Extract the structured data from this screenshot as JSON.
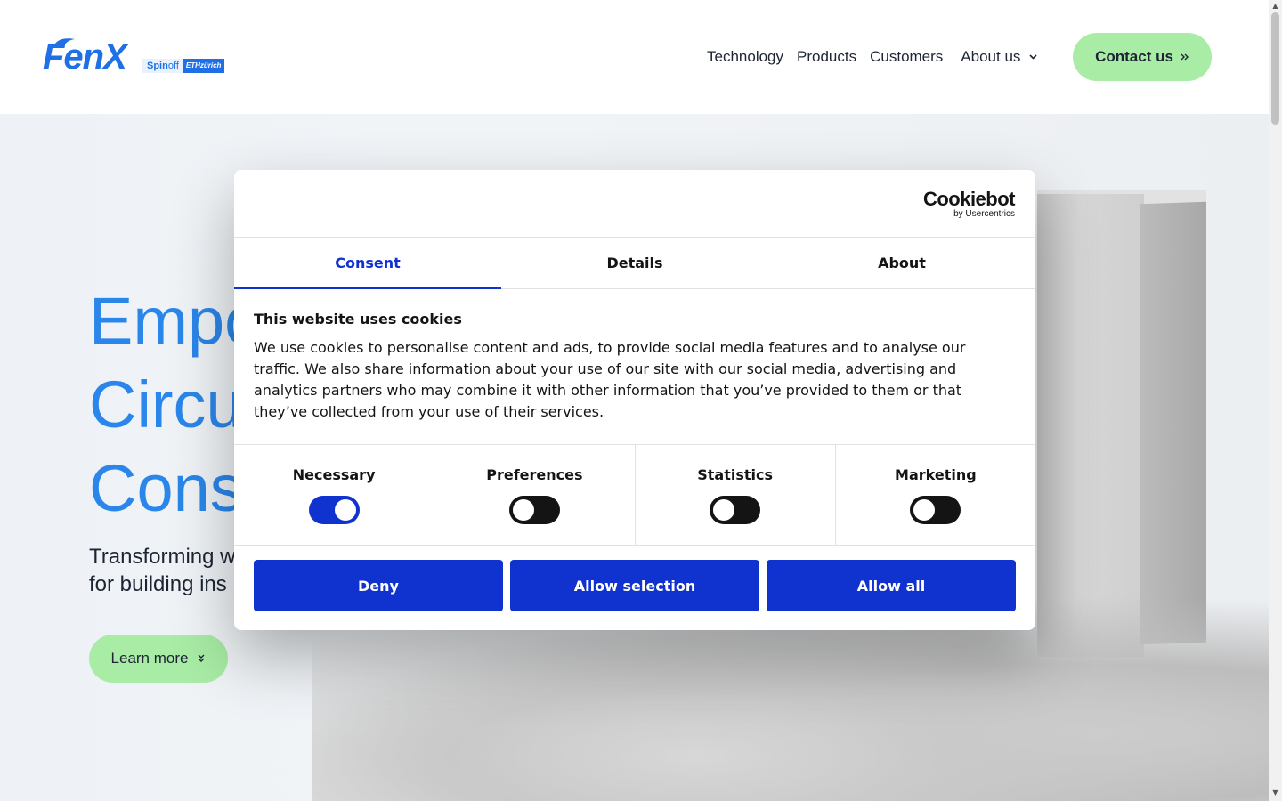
{
  "header": {
    "logo": "FenX",
    "badge": {
      "spin": "Spin",
      "off": "off",
      "eth": "ETHzürich"
    },
    "nav": [
      {
        "label": "Technology"
      },
      {
        "label": "Products"
      },
      {
        "label": "Customers"
      },
      {
        "label": "About us"
      }
    ],
    "contact_label": "Contact us",
    "contact_icon": "double-chevron-right-icon"
  },
  "hero": {
    "title_lines": [
      "Empo",
      "Circu",
      "Cons"
    ],
    "subtitle_lines": [
      "Transforming w",
      "for building ins"
    ],
    "learn_label": "Learn more",
    "learn_icon": "double-chevron-down-icon"
  },
  "cookie": {
    "brand": "Cookiebot",
    "brand_sub": "by Usercentrics",
    "tabs": [
      {
        "label": "Consent",
        "active": true
      },
      {
        "label": "Details",
        "active": false
      },
      {
        "label": "About",
        "active": false
      }
    ],
    "heading": "This website uses cookies",
    "body": "We use cookies to personalise content and ads, to provide social media features and to analyse our traffic. We also share information about your use of our site with our social media, advertising and analytics partners who may combine it with other information that you’ve provided to them or that they’ve collected from your use of their services.",
    "toggles": [
      {
        "label": "Necessary",
        "on": true
      },
      {
        "label": "Preferences",
        "on": false
      },
      {
        "label": "Statistics",
        "on": false
      },
      {
        "label": "Marketing",
        "on": false
      }
    ],
    "buttons": {
      "deny": "Deny",
      "allow_selection": "Allow selection",
      "allow_all": "Allow all"
    }
  },
  "colors": {
    "accent_blue": "#1032cf",
    "brand_blue": "#2a86ea",
    "cta_green": "#a8eca5"
  }
}
